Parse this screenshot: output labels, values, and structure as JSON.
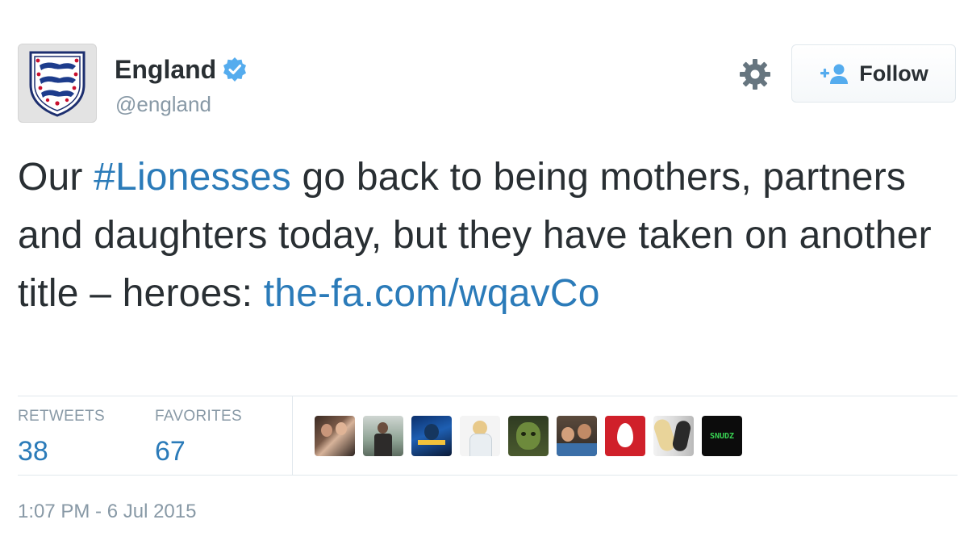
{
  "user": {
    "display_name": "England",
    "screen_name": "@england"
  },
  "follow_button": {
    "label": "Follow"
  },
  "tweet": {
    "text_before": "Our ",
    "hashtag": "#Lionesses",
    "text_middle": " go back to being mothers, partners and daughters today, but they have taken on another title – heroes: ",
    "link": "the-fa.com/wqavCo"
  },
  "stats": {
    "retweets_label": "RETWEETS",
    "retweets_value": "38",
    "favorites_label": "FAVORITES",
    "favorites_value": "67"
  },
  "favoriter_avatars": [
    {
      "name": "favoriter-avatar-1"
    },
    {
      "name": "favoriter-avatar-2"
    },
    {
      "name": "favoriter-avatar-3"
    },
    {
      "name": "favoriter-avatar-4"
    },
    {
      "name": "favoriter-avatar-5"
    },
    {
      "name": "favoriter-avatar-6"
    },
    {
      "name": "favoriter-avatar-7"
    },
    {
      "name": "favoriter-avatar-8"
    },
    {
      "name": "favoriter-avatar-9",
      "text": "SNUDZ"
    }
  ],
  "timestamp": "1:07 PM - 6 Jul 2015",
  "colors": {
    "link_blue": "#2b7bb9",
    "muted_gray": "#8899a6",
    "verified_blue": "#55acee",
    "text_dark": "#292f33"
  },
  "icons": {
    "verified": "verified-badge-icon",
    "settings": "gear-icon",
    "follow": "add-user-icon"
  }
}
